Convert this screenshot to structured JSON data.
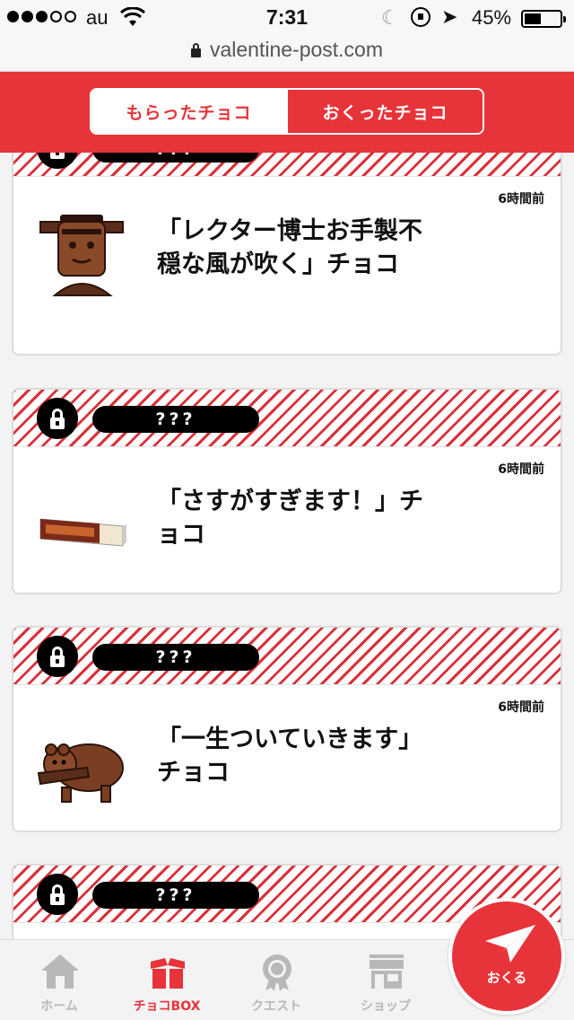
{
  "status_bar": {
    "carrier": "au",
    "time": "7:31",
    "battery_percent": "45%",
    "signal_bars_filled": 3,
    "signal_bars_total": 5,
    "battery_level": 0.45
  },
  "browser": {
    "url": "valentine-post.com"
  },
  "tabs": {
    "received_label": "もらったチョコ",
    "sent_label": "おくったチョコ",
    "active": "received"
  },
  "cards": [
    {
      "sender": "???",
      "timestamp": "6時間前",
      "title": "「レクター博士お手製不穏な風が吹く」チョコ",
      "image": "frankenstein-chocolate"
    },
    {
      "sender": "???",
      "timestamp": "6時間前",
      "title": "「さすがすぎます！」チョコ",
      "image": "chocolate-bar-box"
    },
    {
      "sender": "???",
      "timestamp": "6時間前",
      "title": "「一生ついていきます」チョコ",
      "image": "bear-chocolate"
    },
    {
      "sender": "???"
    }
  ],
  "bottom_nav": {
    "home": "ホーム",
    "choco_box": "チョコBOX",
    "quest": "クエスト",
    "shop": "ショップ",
    "active": "choco_box"
  },
  "send_button": {
    "label": "おくる"
  },
  "colors": {
    "brand_red": "#e7333a",
    "nav_inactive": "#b8b8b8"
  }
}
